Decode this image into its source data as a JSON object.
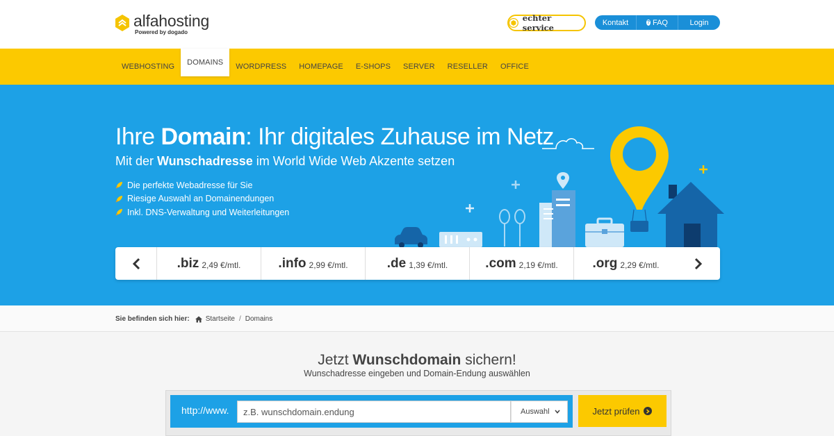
{
  "header": {
    "logo_name": "alfahosting",
    "logo_sub": "Powered by dogado",
    "service_label": "echter service",
    "nav": {
      "contact": "Kontakt",
      "faq": "FAQ",
      "login": "Login"
    }
  },
  "mainnav": {
    "items": [
      "WEBHOSTING",
      "DOMAINS",
      "WORDPRESS",
      "HOMEPAGE",
      "E-SHOPS",
      "SERVER",
      "RESELLER",
      "OFFICE"
    ],
    "active_index": 1
  },
  "hero": {
    "title_pre": "Ihre ",
    "title_bold": "Domain",
    "title_post": ": Ihr digitales Zuhause im Netz",
    "sub_pre": "Mit der ",
    "sub_bold": "Wunschadresse",
    "sub_post": " im World Wide Web Akzente setzen",
    "features": [
      "Die perfekte Webadresse für Sie",
      "Riesige Auswahl an Domainendungen",
      "Inkl. DNS-Verwaltung und Weiterleitungen"
    ]
  },
  "slider": {
    "domains": [
      {
        "tld": ".biz",
        "price": "2,49 €/mtl."
      },
      {
        "tld": ".info",
        "price": "2,99 €/mtl."
      },
      {
        "tld": ".de",
        "price": "1,39 €/mtl."
      },
      {
        "tld": ".com",
        "price": "2,19 €/mtl."
      },
      {
        "tld": ".org",
        "price": "2,29 €/mtl."
      }
    ]
  },
  "breadcrumb": {
    "label": "Sie befinden sich hier:",
    "home": "Startseite",
    "separator": "/",
    "current": "Domains"
  },
  "search": {
    "title_pre": "Jetzt ",
    "title_bold": "Wunschdomain",
    "title_post": " sichern!",
    "subtitle": "Wunschadresse eingeben und Domain-Endung auswählen",
    "prefix": "http://www.",
    "placeholder": "z.B. wunschdomain.endung",
    "select_value": "Auswahl",
    "button_label": "Jetzt prüfen"
  },
  "colors": {
    "yellow": "#fcc900",
    "blue": "#1da1e6",
    "navblue": "#1a8fd8"
  }
}
